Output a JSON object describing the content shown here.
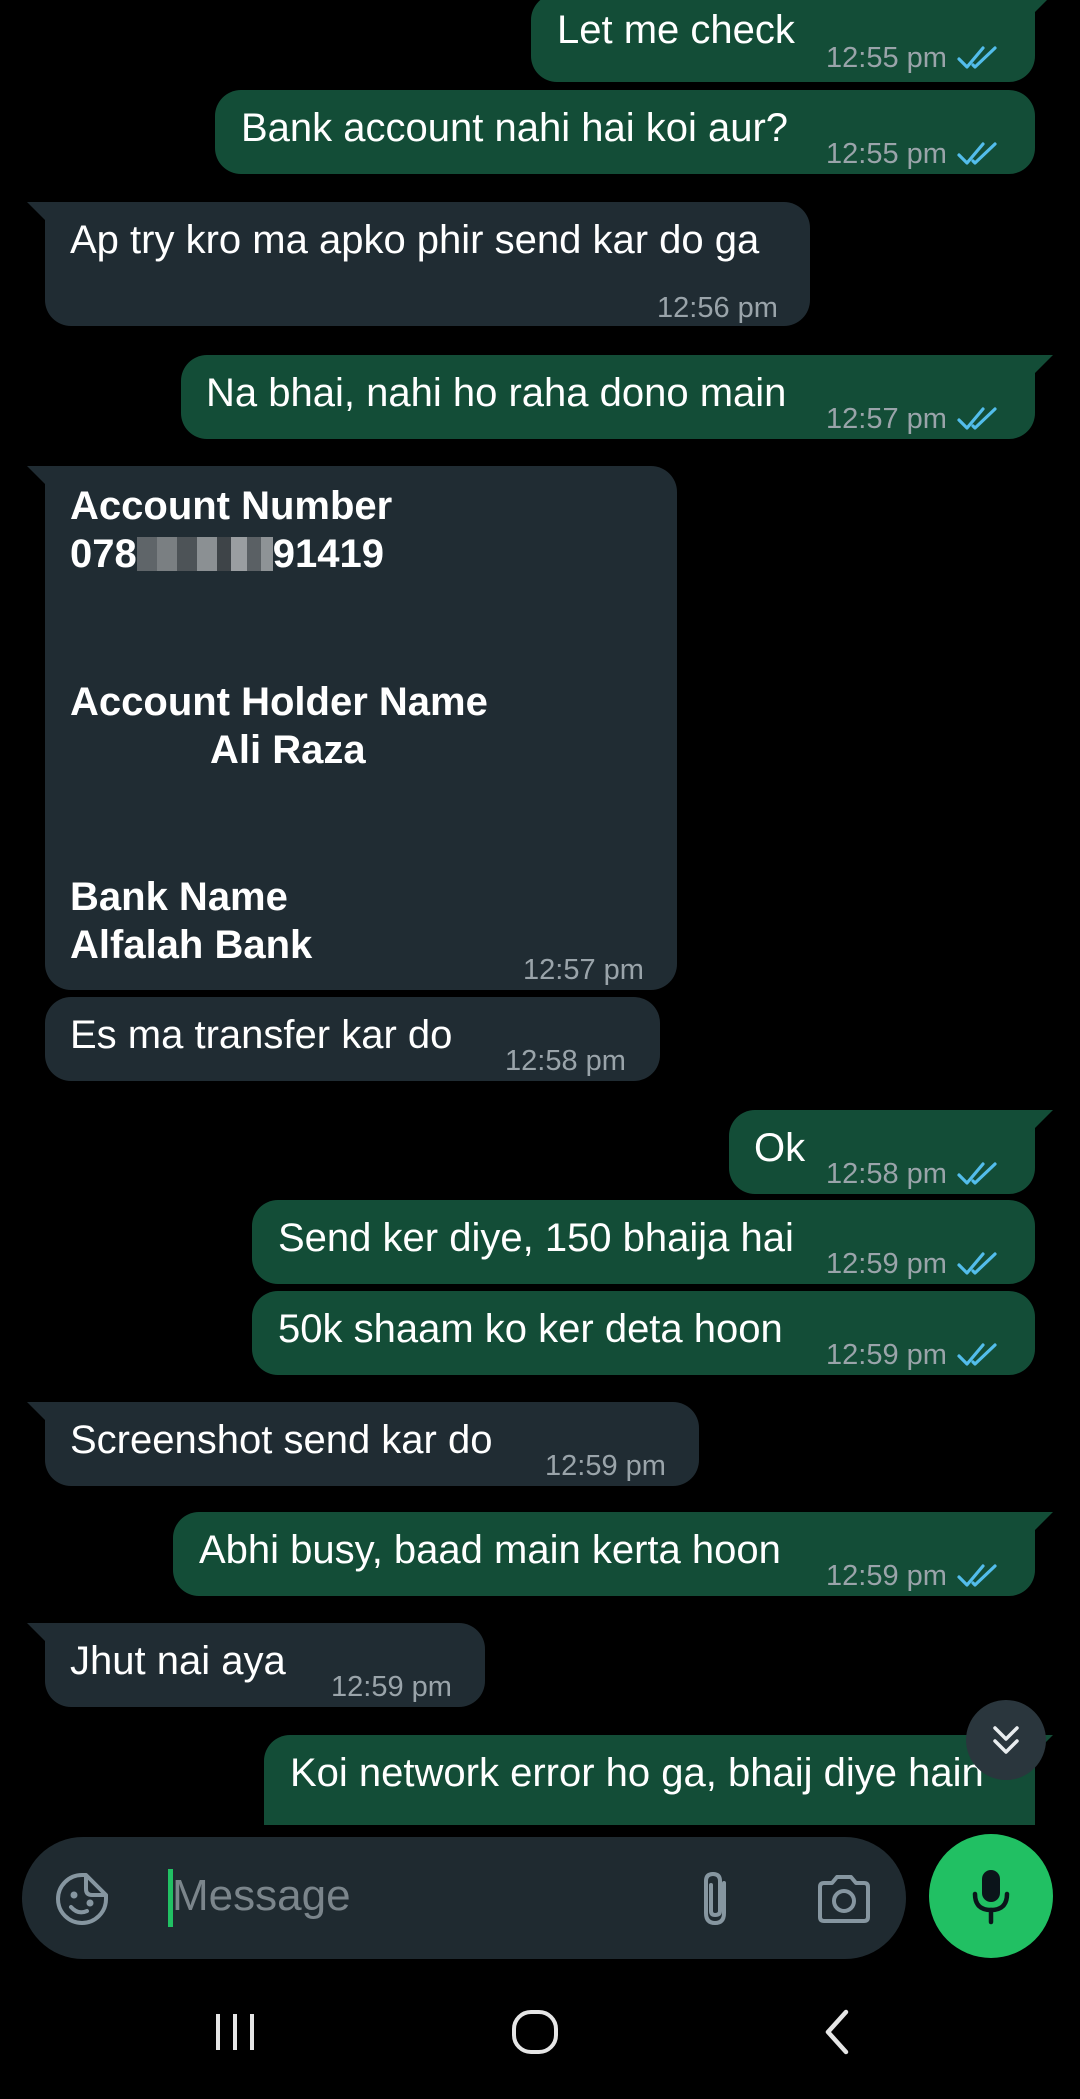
{
  "messages": [
    {
      "text": "Let me check",
      "time": "12:55 pm"
    },
    {
      "text": "Bank account nahi hai koi aur?",
      "time": "12:55 pm"
    },
    {
      "text": "Ap try kro ma apko phir send kar do ga",
      "time": "12:56 pm"
    },
    {
      "text": "Na bhai, nahi ho raha dono main",
      "time": "12:57 pm"
    },
    {
      "account_label": "Account Number",
      "account_prefix": "078",
      "account_suffix": "91419",
      "holder_label": "Account Holder Name",
      "holder_name": "Ali Raza",
      "bank_label": "Bank Name",
      "bank_name": "Alfalah Bank",
      "time": "12:57 pm"
    },
    {
      "text": "Es ma transfer kar do",
      "time": "12:58 pm"
    },
    {
      "text": "Ok",
      "time": "12:58 pm"
    },
    {
      "text": "Send ker diye, 150 bhaija hai",
      "time": "12:59 pm"
    },
    {
      "text": "50k shaam ko ker deta hoon",
      "time": "12:59 pm"
    },
    {
      "text": "Screenshot send kar do",
      "time": "12:59 pm"
    },
    {
      "text": "Abhi busy, baad main kerta hoon",
      "time": "12:59 pm"
    },
    {
      "text": "Jhut nai aya",
      "time": "12:59 pm"
    },
    {
      "text": "Koi network error ho ga, bhaij diye hain"
    }
  ],
  "composer": {
    "placeholder": "Message"
  },
  "icons": {
    "emoji": "sticker-icon",
    "attach": "paperclip-icon",
    "camera": "camera-icon",
    "mic": "mic-icon",
    "scroll": "double-chevron-down-icon",
    "read": "double-check-icon",
    "nav_recents": "recents-icon",
    "nav_home": "home-icon",
    "nav_back": "back-icon"
  },
  "colors": {
    "outgoing": "#134d37",
    "incoming": "#202c33",
    "accent": "#21c063",
    "read_ticks": "#53bdeb"
  }
}
